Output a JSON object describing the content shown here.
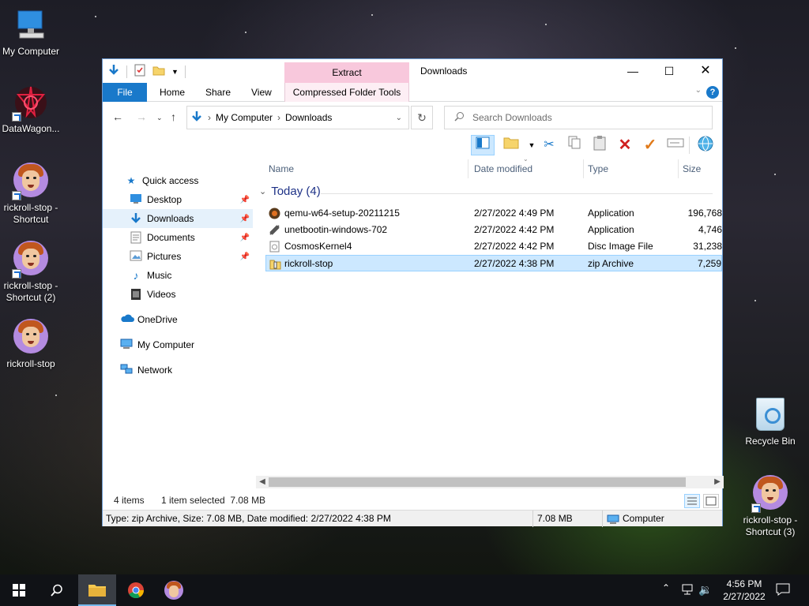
{
  "desktop": {
    "icons": [
      {
        "label": "My Computer"
      },
      {
        "label": "DataWagon..."
      },
      {
        "label": "rickroll-stop - Shortcut"
      },
      {
        "label": "rickroll-stop - Shortcut (2)"
      },
      {
        "label": "rickroll-stop"
      },
      {
        "label": "Recycle Bin"
      },
      {
        "label": "rickroll-stop - Shortcut (3)"
      }
    ]
  },
  "window": {
    "title": "Downloads",
    "context_tab_header": "Extract",
    "ribbon_tabs": [
      "File",
      "Home",
      "Share",
      "View",
      "Compressed Folder Tools"
    ],
    "help_label": "?",
    "address": {
      "crumbs": [
        "My Computer",
        "Downloads"
      ]
    },
    "search": {
      "placeholder": "Search Downloads"
    },
    "sidebar": {
      "items": [
        {
          "label": "Quick access",
          "icon": "star-icon",
          "pinned": false
        },
        {
          "label": "Desktop",
          "icon": "desktop-folder-icon",
          "pinned": true
        },
        {
          "label": "Downloads",
          "icon": "download-folder-icon",
          "pinned": true,
          "selected": true
        },
        {
          "label": "Documents",
          "icon": "documents-folder-icon",
          "pinned": true
        },
        {
          "label": "Pictures",
          "icon": "pictures-folder-icon",
          "pinned": true
        },
        {
          "label": "Music",
          "icon": "music-folder-icon",
          "pinned": false
        },
        {
          "label": "Videos",
          "icon": "videos-folder-icon",
          "pinned": false
        },
        {
          "label": "OneDrive",
          "icon": "cloud-icon",
          "pinned": false
        },
        {
          "label": "My Computer",
          "icon": "computer-icon",
          "pinned": false
        },
        {
          "label": "Network",
          "icon": "network-icon",
          "pinned": false
        }
      ]
    },
    "columns": [
      "Name",
      "Date modified",
      "Type",
      "Size"
    ],
    "group_header": "Today (4)",
    "files": [
      {
        "name": "qemu-w64-setup-20211215",
        "date": "2/27/2022 4:49 PM",
        "type": "Application",
        "size": "196,768"
      },
      {
        "name": "unetbootin-windows-702",
        "date": "2/27/2022 4:42 PM",
        "type": "Application",
        "size": "4,746"
      },
      {
        "name": "CosmosKernel4",
        "date": "2/27/2022 4:42 PM",
        "type": "Disc Image File",
        "size": "31,238"
      },
      {
        "name": "rickroll-stop",
        "date": "2/27/2022 4:38 PM",
        "type": "zip Archive",
        "size": "7,259",
        "selected": true
      }
    ],
    "status": {
      "items_count": "4 items",
      "selection": "1 item selected  7.08 MB"
    },
    "details": {
      "text": "Type: zip Archive, Size: 7.08 MB, Date modified: 2/27/2022 4:38 PM",
      "size": "7.08 MB",
      "location": "Computer"
    }
  },
  "taskbar": {
    "time": "4:56 PM",
    "date": "2/27/2022"
  },
  "colors": {
    "accent": "#1979ca",
    "selection": "#cce8ff",
    "extract_tab": "#f8c8dc"
  }
}
